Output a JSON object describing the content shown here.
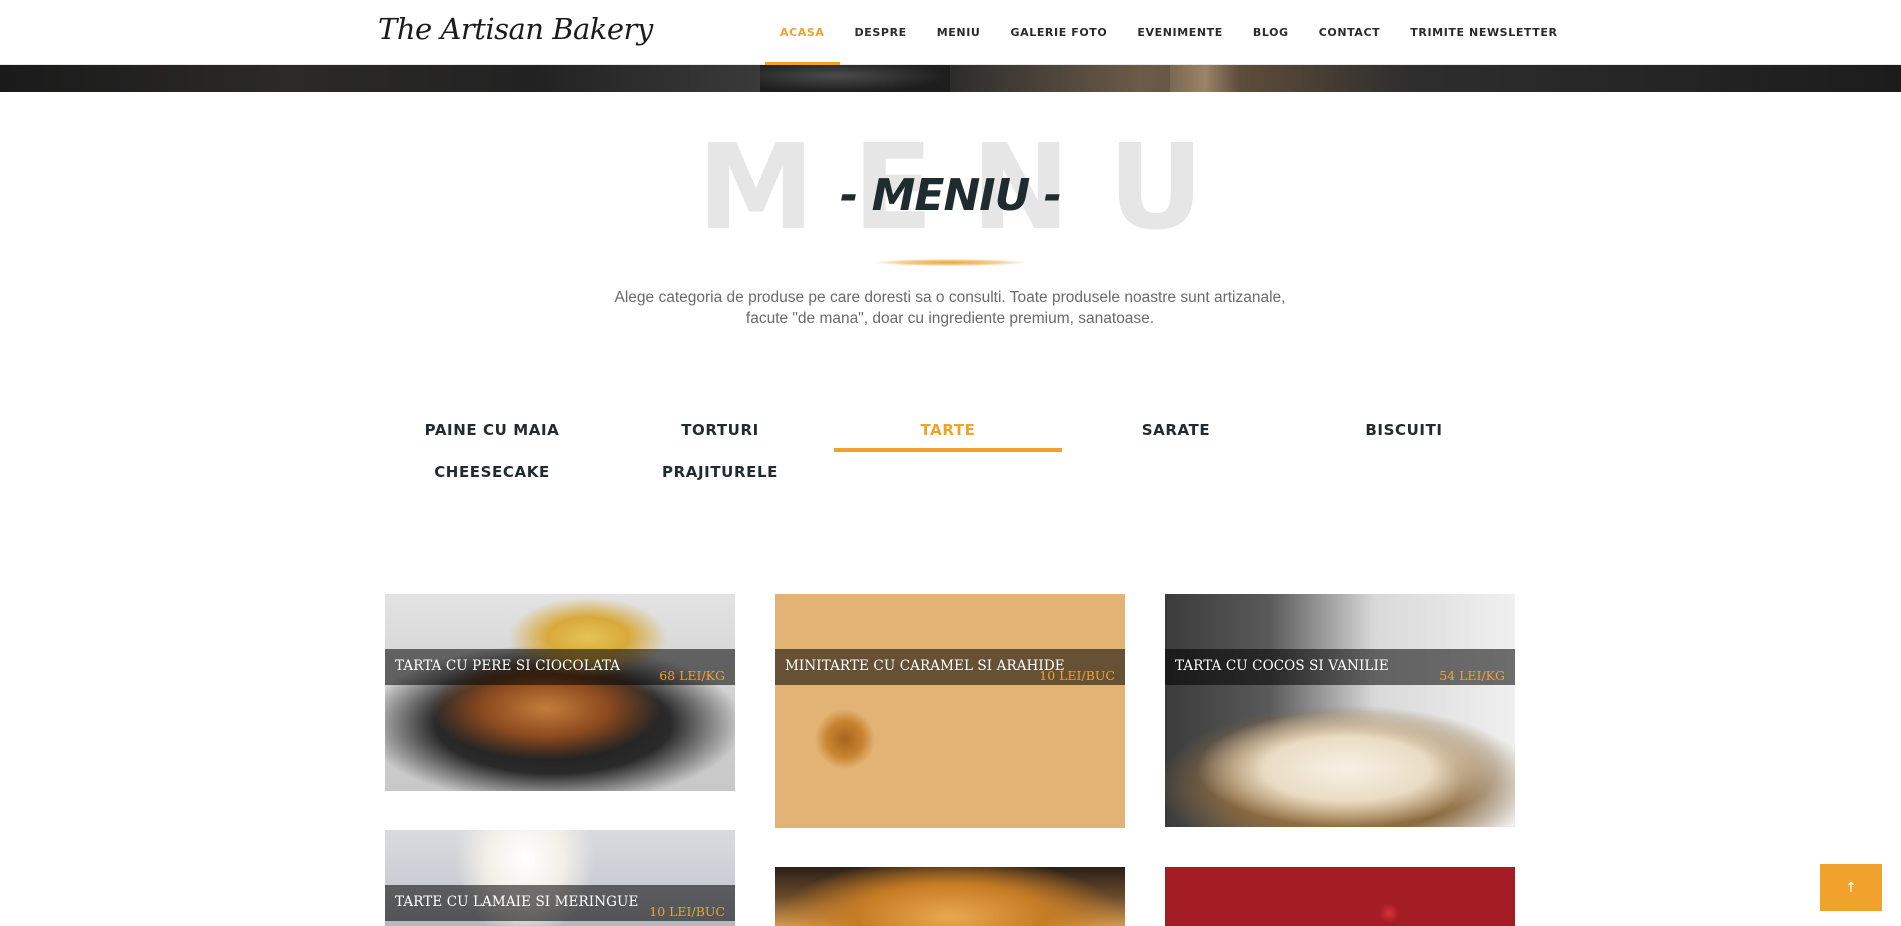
{
  "header": {
    "brand": "The Artisan Bakery",
    "nav": [
      {
        "label": "ACASA",
        "active": true
      },
      {
        "label": "DESPRE",
        "active": false
      },
      {
        "label": "MENIU",
        "active": false
      },
      {
        "label": "GALERIE FOTO",
        "active": false
      },
      {
        "label": "EVENIMENTE",
        "active": false
      },
      {
        "label": "BLOG",
        "active": false
      },
      {
        "label": "CONTACT",
        "active": false
      },
      {
        "label": "TRIMITE NEWSLETTER",
        "active": false
      }
    ]
  },
  "section": {
    "background_word": "MENU",
    "title": "- MENIU -",
    "intro_line1": "Alege categoria de produse pe care doresti sa o consulti. Toate produsele noastre sunt artizanale,",
    "intro_line2": "facute \"de mana\", doar cu ingrediente premium, sanatoase."
  },
  "categories": [
    {
      "label": "PAINE CU MAIA",
      "active": false
    },
    {
      "label": "TORTURI",
      "active": false
    },
    {
      "label": "TARTE",
      "active": true
    },
    {
      "label": "SARATE",
      "active": false
    },
    {
      "label": "BISCUITI",
      "active": false
    },
    {
      "label": "CHEESECAKE",
      "active": false
    },
    {
      "label": "PRAJITURELE",
      "active": false
    }
  ],
  "products": [
    {
      "name": "TARTA CU PERE SI CIOCOLATA",
      "price": "68 LEI/KG",
      "image": "pear-chocolate-tart-photo"
    },
    {
      "name": "MINITARTE CU CARAMEL SI ARAHIDE",
      "price": "10 LEI/BUC",
      "image": "caramel-peanut-minitarts-photo"
    },
    {
      "name": "TARTA CU COCOS SI VANILIE",
      "price": "54 LEI/KG",
      "image": "coconut-vanilla-tart-photo"
    },
    {
      "name": "TARTE CU LAMAIE SI MERINGUE",
      "price": "10 LEI/BUC",
      "image": "lemon-meringue-tart-photo"
    },
    {
      "name": "",
      "price": "",
      "image": "tart-photo"
    },
    {
      "name": "",
      "price": "",
      "image": "chocolate-raspberry-tart-photo"
    }
  ],
  "back_to_top": {
    "icon": "arrow-up-icon",
    "glyph": "↑"
  },
  "colors": {
    "accent": "#f0a22d",
    "heading": "#1f2b2e",
    "text": "#6a6a6a"
  }
}
